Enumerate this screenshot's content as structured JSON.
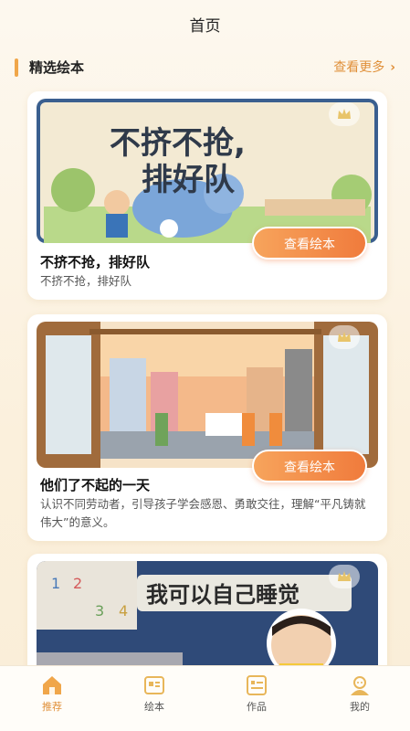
{
  "header": {
    "title": "首页"
  },
  "section": {
    "title": "精选绘本",
    "more_label": "查看更多"
  },
  "cards": [
    {
      "cover_text": [
        "不挤不抢,",
        "排好队"
      ],
      "title": "不挤不抢，排好队",
      "description": "不挤不抢，排好队",
      "button_label": "查看绘本"
    },
    {
      "title": "他们了不起的一天",
      "description": "认识不同劳动者，引导孩子学会感恩、勇敢交往，理解“平凡铸就伟大”的意义。",
      "button_label": "查看绘本"
    },
    {
      "cover_text": "我可以自己睡觉"
    }
  ],
  "tabbar": {
    "items": [
      {
        "label": "推荐",
        "icon": "home-icon",
        "active": true
      },
      {
        "label": "绘本",
        "icon": "book-icon",
        "active": false
      },
      {
        "label": "作品",
        "icon": "works-icon",
        "active": false
      },
      {
        "label": "我的",
        "icon": "profile-icon",
        "active": false
      }
    ]
  },
  "colors": {
    "accent": "#f0a64a",
    "button": "#f07b3c"
  }
}
